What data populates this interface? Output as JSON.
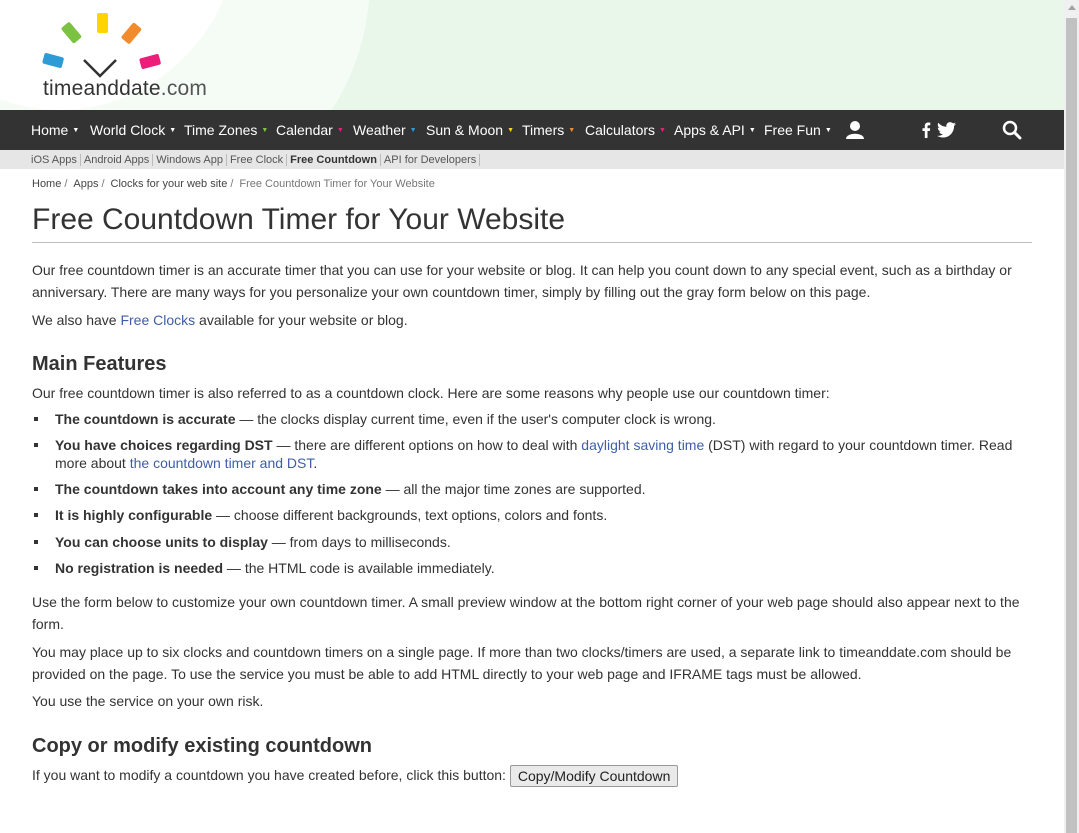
{
  "logo": {
    "name": "timeanddate",
    "tld": ".com"
  },
  "nav": {
    "items": [
      {
        "label": "Home"
      },
      {
        "label": "World Clock"
      },
      {
        "label": "Time Zones"
      },
      {
        "label": "Calendar"
      },
      {
        "label": "Weather"
      },
      {
        "label": "Sun & Moon"
      },
      {
        "label": "Timers"
      },
      {
        "label": "Calculators"
      },
      {
        "label": "Apps & API"
      },
      {
        "label": "Free Fun"
      }
    ],
    "icons": [
      "user-icon",
      "facebook-icon",
      "twitter-icon",
      "search-icon"
    ],
    "bg": "#333333"
  },
  "subnav": {
    "items": [
      "iOS Apps",
      "Android Apps",
      "Windows App",
      "Free Clock",
      "Free Countdown",
      "API for Developers"
    ],
    "active": "Free Countdown"
  },
  "breadcrumb": {
    "items": [
      "Home",
      "Apps",
      "Clocks for your web site"
    ],
    "current": "Free Countdown Timer for Your Website"
  },
  "page": {
    "title": "Free Countdown Timer for Your Website",
    "intro": "Our free countdown timer is an accurate timer that you can use for your website or blog. It can help you count down to any special event, such as a birthday or anniversary. There are many ways for you personalize your own countdown timer, simply by filling out the gray form below on this page.",
    "also_prefix": "We also have ",
    "also_link": "Free Clocks",
    "also_suffix": " available for your website or blog.",
    "features_heading": "Main Features",
    "features_intro": "Our free countdown timer is also referred to as a countdown clock. Here are some reasons why people use our countdown timer:",
    "features": [
      {
        "bold": "The countdown is accurate",
        "text": " — the clocks display current time, even if the user's computer clock is wrong."
      },
      {
        "bold": "You have choices regarding DST",
        "text1": " — there are different options on how to deal with ",
        "link1": "daylight saving time",
        "text2": " (DST) with regard to your countdown timer. Read more about ",
        "link2": "the countdown timer and DST",
        "text3": "."
      },
      {
        "bold": "The countdown takes into account any time zone",
        "text": " — all the major time zones are supported."
      },
      {
        "bold": "It is highly configurable",
        "text": " — choose different backgrounds, text options, colors and fonts."
      },
      {
        "bold": "You can choose units to display",
        "text": " — from days to milliseconds."
      },
      {
        "bold": "No registration is needed",
        "text": " — the HTML code is available immediately."
      }
    ],
    "para_form": "Use the form below to customize your own countdown timer. A small preview window at the bottom right corner of your web page should also appear next to the form.",
    "para_six": "You may place up to six clocks and countdown timers on a single page. If more than two clocks/timers are used, a separate link to timeanddate.com should be provided on the page. To use the service you must be able to add HTML directly to your web page and IFRAME tags must be allowed.",
    "para_risk": "You use the service on your own risk.",
    "copy_heading": "Copy or modify existing countdown",
    "copy_text": "If you want to modify a countdown you have created before, click this button: ",
    "copy_button": "Copy/Modify Countdown"
  },
  "colors": {
    "link": "#3e5ea8",
    "header_bg": "#e9f6ea",
    "logo_green": "#7cc242",
    "logo_yellow": "#ffd400",
    "logo_orange": "#f08c2e",
    "logo_pink": "#ec1e79",
    "logo_blue": "#2e9ad6"
  }
}
